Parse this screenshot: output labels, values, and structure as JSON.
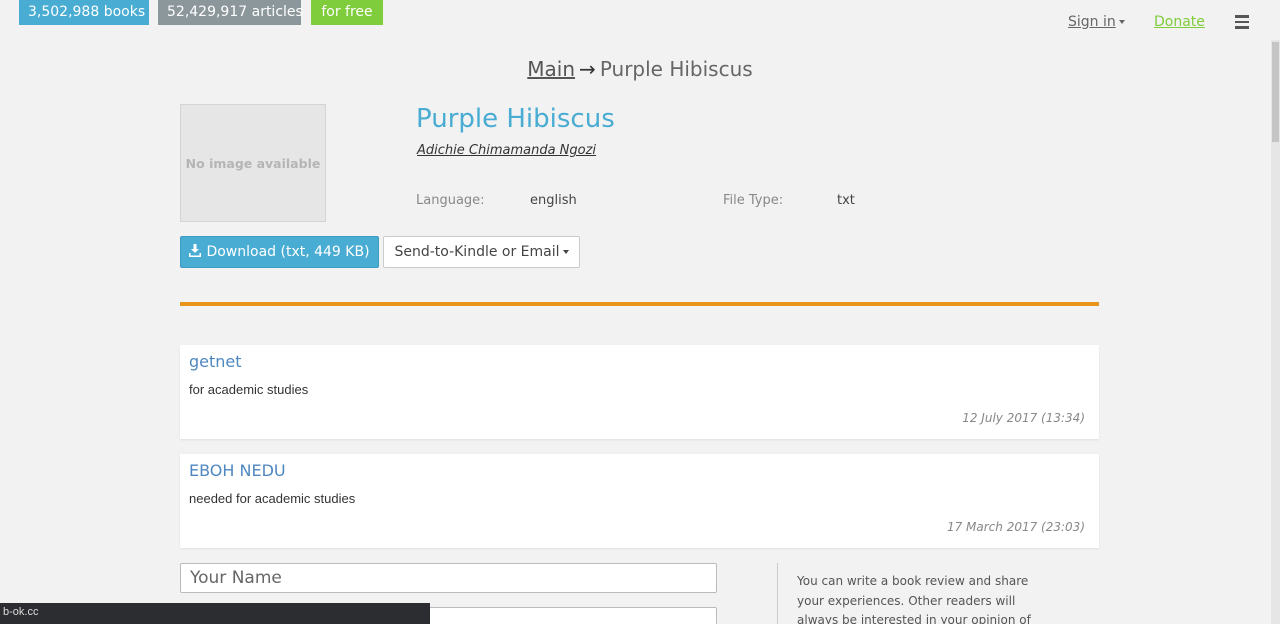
{
  "badges": {
    "books": "3,502,988 books",
    "articles": "52,429,917 articles",
    "free": "for free"
  },
  "nav": {
    "signin": "Sign in",
    "donate": "Donate",
    "menu_icon": "hamburger-icon"
  },
  "breadcrumb": {
    "main": "Main",
    "arrow": "→",
    "current": "Purple Hibiscus"
  },
  "book": {
    "cover_text": "No image available",
    "title": "Purple Hibiscus",
    "author": "Adichie Chimamanda Ngozi",
    "language_label": "Language:",
    "language_value": "english",
    "filetype_label": "File Type:",
    "filetype_value": "txt"
  },
  "actions": {
    "download_label": "Download (txt, 449 KB)",
    "download_icon": "download-icon",
    "kindle_label": "Send-to-Kindle or Email"
  },
  "comments": [
    {
      "author": "getnet",
      "text": "for academic studies",
      "date": "12 July 2017 (13:34)"
    },
    {
      "author": "EBOH NEDU",
      "text": "needed for academic studies",
      "date": "17 March 2017 (23:03)"
    }
  ],
  "review_form": {
    "name_placeholder": "Your Name",
    "note": "You can write a book review and share your experiences. Other readers will always be interested in your opinion of"
  },
  "statusbar": {
    "url": "b-ok.cc"
  },
  "colors": {
    "accent": "#49acd3",
    "divider": "#e8961b",
    "free_badge": "#7fcc3c",
    "articles_badge": "#8c979c"
  }
}
